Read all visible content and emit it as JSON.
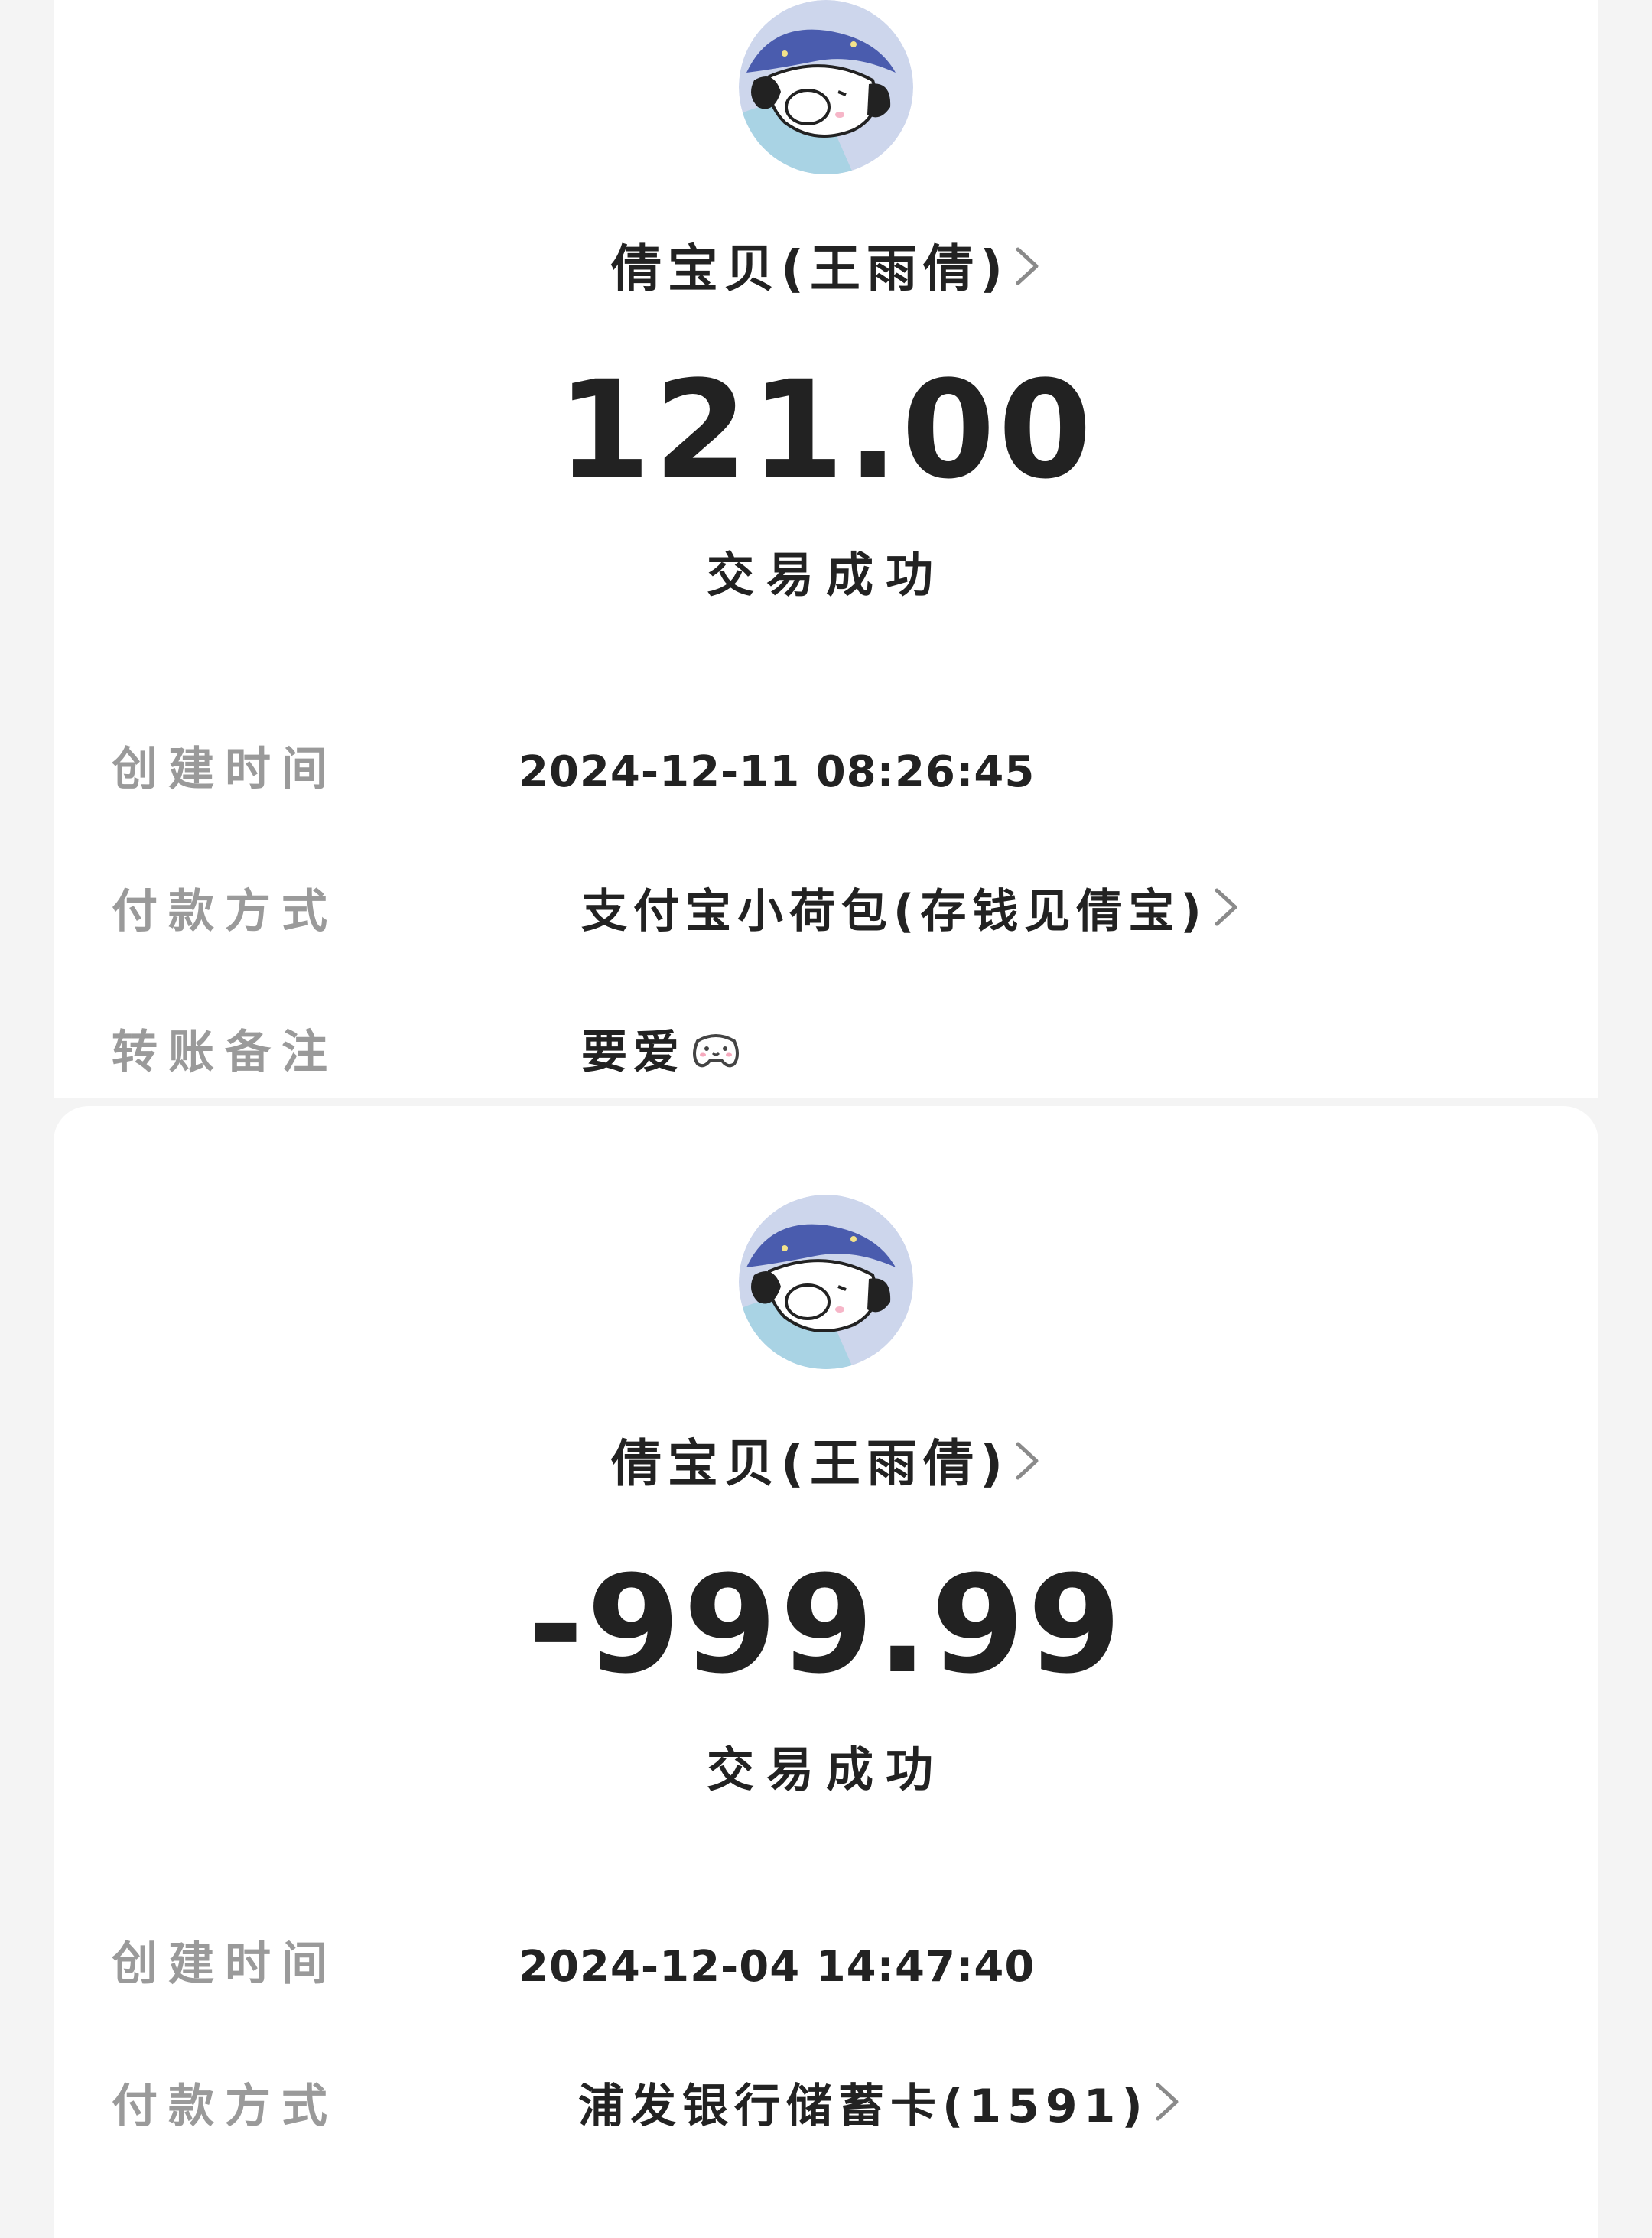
{
  "records": [
    {
      "contact_name": "倩宝贝(王雨倩)",
      "amount": "121.00",
      "status": "交易成功",
      "details": {
        "created_label": "创建时间",
        "created_value": "2024-12-11 08:26:45",
        "payment_label": "付款方式",
        "payment_value": "支付宝小荷包(存钱见倩宝)",
        "note_label": "转账备注",
        "note_value": "要爱"
      }
    },
    {
      "contact_name": "倩宝贝(王雨倩)",
      "amount": "-999.99",
      "status": "交易成功",
      "details": {
        "created_label": "创建时间",
        "created_value": "2024-12-04 14:47:40",
        "payment_label": "付款方式",
        "payment_value": "浦发银行储蓄卡(1591)"
      }
    }
  ],
  "icons": {
    "avatar": "cartoon-dog-avatar-icon",
    "chevron": "chevron-right-icon",
    "note_emoji": "gamepad-face-emoji-icon"
  },
  "colors": {
    "background": "#f4f4f4",
    "card": "#ffffff",
    "primary_text": "#222222",
    "label_text": "#9a9a9a",
    "chevron": "#8a8a8a"
  }
}
